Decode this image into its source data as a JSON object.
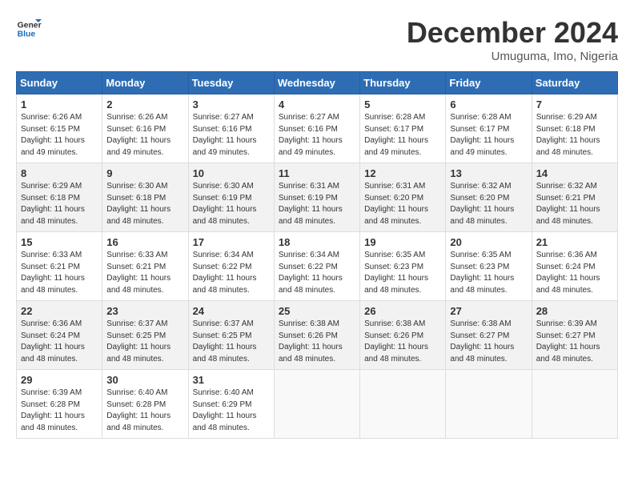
{
  "header": {
    "logo_general": "General",
    "logo_blue": "Blue",
    "month_title": "December 2024",
    "location": "Umuguma, Imo, Nigeria"
  },
  "days_of_week": [
    "Sunday",
    "Monday",
    "Tuesday",
    "Wednesday",
    "Thursday",
    "Friday",
    "Saturday"
  ],
  "weeks": [
    [
      {
        "day": "1",
        "info": "Sunrise: 6:26 AM\nSunset: 6:15 PM\nDaylight: 11 hours and 49 minutes."
      },
      {
        "day": "2",
        "info": "Sunrise: 6:26 AM\nSunset: 6:16 PM\nDaylight: 11 hours and 49 minutes."
      },
      {
        "day": "3",
        "info": "Sunrise: 6:27 AM\nSunset: 6:16 PM\nDaylight: 11 hours and 49 minutes."
      },
      {
        "day": "4",
        "info": "Sunrise: 6:27 AM\nSunset: 6:16 PM\nDaylight: 11 hours and 49 minutes."
      },
      {
        "day": "5",
        "info": "Sunrise: 6:28 AM\nSunset: 6:17 PM\nDaylight: 11 hours and 49 minutes."
      },
      {
        "day": "6",
        "info": "Sunrise: 6:28 AM\nSunset: 6:17 PM\nDaylight: 11 hours and 49 minutes."
      },
      {
        "day": "7",
        "info": "Sunrise: 6:29 AM\nSunset: 6:18 PM\nDaylight: 11 hours and 48 minutes."
      }
    ],
    [
      {
        "day": "8",
        "info": "Sunrise: 6:29 AM\nSunset: 6:18 PM\nDaylight: 11 hours and 48 minutes."
      },
      {
        "day": "9",
        "info": "Sunrise: 6:30 AM\nSunset: 6:18 PM\nDaylight: 11 hours and 48 minutes."
      },
      {
        "day": "10",
        "info": "Sunrise: 6:30 AM\nSunset: 6:19 PM\nDaylight: 11 hours and 48 minutes."
      },
      {
        "day": "11",
        "info": "Sunrise: 6:31 AM\nSunset: 6:19 PM\nDaylight: 11 hours and 48 minutes."
      },
      {
        "day": "12",
        "info": "Sunrise: 6:31 AM\nSunset: 6:20 PM\nDaylight: 11 hours and 48 minutes."
      },
      {
        "day": "13",
        "info": "Sunrise: 6:32 AM\nSunset: 6:20 PM\nDaylight: 11 hours and 48 minutes."
      },
      {
        "day": "14",
        "info": "Sunrise: 6:32 AM\nSunset: 6:21 PM\nDaylight: 11 hours and 48 minutes."
      }
    ],
    [
      {
        "day": "15",
        "info": "Sunrise: 6:33 AM\nSunset: 6:21 PM\nDaylight: 11 hours and 48 minutes."
      },
      {
        "day": "16",
        "info": "Sunrise: 6:33 AM\nSunset: 6:21 PM\nDaylight: 11 hours and 48 minutes."
      },
      {
        "day": "17",
        "info": "Sunrise: 6:34 AM\nSunset: 6:22 PM\nDaylight: 11 hours and 48 minutes."
      },
      {
        "day": "18",
        "info": "Sunrise: 6:34 AM\nSunset: 6:22 PM\nDaylight: 11 hours and 48 minutes."
      },
      {
        "day": "19",
        "info": "Sunrise: 6:35 AM\nSunset: 6:23 PM\nDaylight: 11 hours and 48 minutes."
      },
      {
        "day": "20",
        "info": "Sunrise: 6:35 AM\nSunset: 6:23 PM\nDaylight: 11 hours and 48 minutes."
      },
      {
        "day": "21",
        "info": "Sunrise: 6:36 AM\nSunset: 6:24 PM\nDaylight: 11 hours and 48 minutes."
      }
    ],
    [
      {
        "day": "22",
        "info": "Sunrise: 6:36 AM\nSunset: 6:24 PM\nDaylight: 11 hours and 48 minutes."
      },
      {
        "day": "23",
        "info": "Sunrise: 6:37 AM\nSunset: 6:25 PM\nDaylight: 11 hours and 48 minutes."
      },
      {
        "day": "24",
        "info": "Sunrise: 6:37 AM\nSunset: 6:25 PM\nDaylight: 11 hours and 48 minutes."
      },
      {
        "day": "25",
        "info": "Sunrise: 6:38 AM\nSunset: 6:26 PM\nDaylight: 11 hours and 48 minutes."
      },
      {
        "day": "26",
        "info": "Sunrise: 6:38 AM\nSunset: 6:26 PM\nDaylight: 11 hours and 48 minutes."
      },
      {
        "day": "27",
        "info": "Sunrise: 6:38 AM\nSunset: 6:27 PM\nDaylight: 11 hours and 48 minutes."
      },
      {
        "day": "28",
        "info": "Sunrise: 6:39 AM\nSunset: 6:27 PM\nDaylight: 11 hours and 48 minutes."
      }
    ],
    [
      {
        "day": "29",
        "info": "Sunrise: 6:39 AM\nSunset: 6:28 PM\nDaylight: 11 hours and 48 minutes."
      },
      {
        "day": "30",
        "info": "Sunrise: 6:40 AM\nSunset: 6:28 PM\nDaylight: 11 hours and 48 minutes."
      },
      {
        "day": "31",
        "info": "Sunrise: 6:40 AM\nSunset: 6:29 PM\nDaylight: 11 hours and 48 minutes."
      },
      {
        "day": "",
        "info": ""
      },
      {
        "day": "",
        "info": ""
      },
      {
        "day": "",
        "info": ""
      },
      {
        "day": "",
        "info": ""
      }
    ]
  ]
}
